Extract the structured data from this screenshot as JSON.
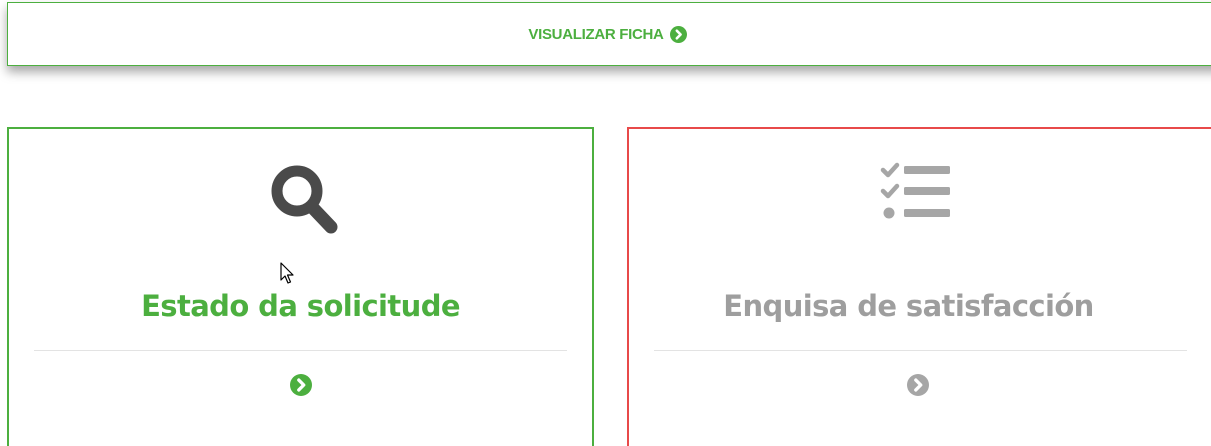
{
  "ficha": {
    "label": "VISUALIZAR FICHA"
  },
  "cards": [
    {
      "title": "Estado da solicitude",
      "icon": "search-icon",
      "color": "#4caf3f"
    },
    {
      "title": "Enquisa de satisfacción",
      "icon": "checklist-icon",
      "color": "#9e9e9e"
    }
  ],
  "colors": {
    "green": "#4caf3f",
    "red": "#e84a4a",
    "gray_icon": "#a6a6a6",
    "dark_icon": "#4a4a4a"
  }
}
